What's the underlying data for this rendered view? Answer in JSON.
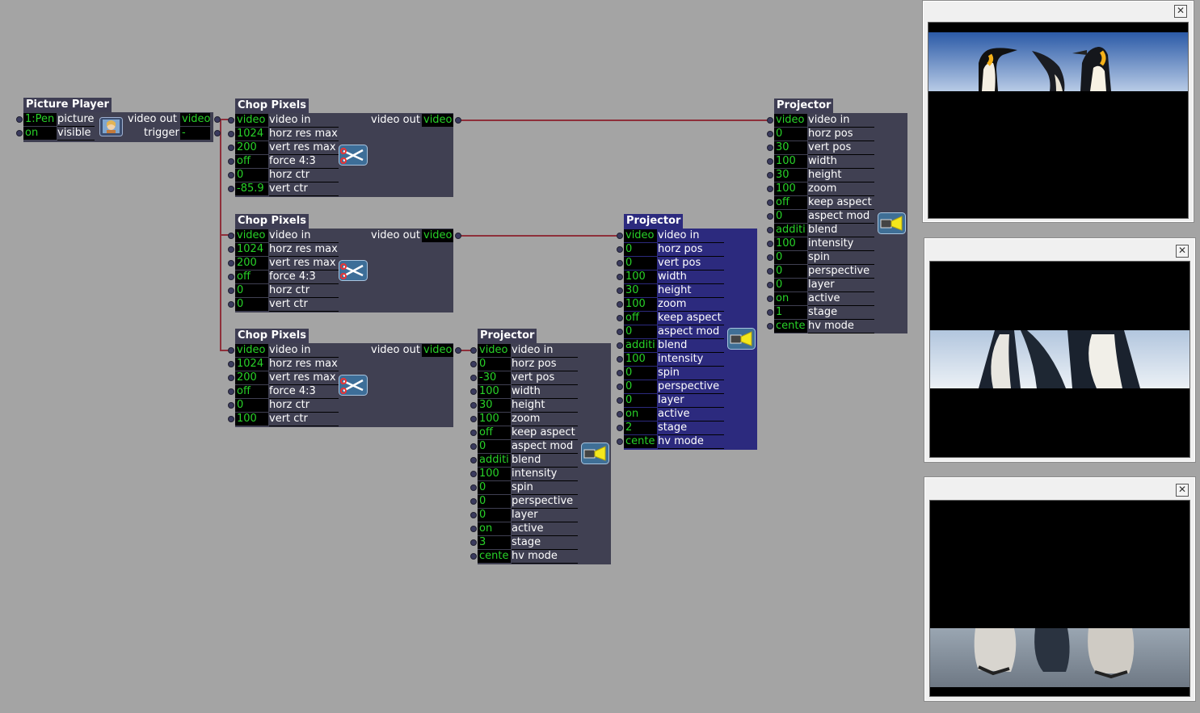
{
  "colors": {
    "background": "#a4a4a4",
    "module": "#404052",
    "selected_module": "#2c2a7e",
    "value_text": "#28d228",
    "wire": "#8e2f3a"
  },
  "picture_player": {
    "title": "Picture Player",
    "inputs": [
      {
        "value": "1:Pen",
        "label": "picture"
      },
      {
        "value": "on",
        "label": "visible"
      }
    ],
    "outputs": [
      {
        "label": "video out",
        "value": "video"
      },
      {
        "label": "trigger",
        "value": "-"
      }
    ],
    "icon": "picture-thumbnail-icon"
  },
  "chop1": {
    "title": "Chop Pixels",
    "out_label": "video out",
    "out_value": "video",
    "rows": [
      {
        "value": "video",
        "label": "video in"
      },
      {
        "value": "1024",
        "label": "horz res max"
      },
      {
        "value": "200",
        "label": "vert res max"
      },
      {
        "value": "off",
        "label": "force 4:3"
      },
      {
        "value": "0",
        "label": "horz ctr"
      },
      {
        "value": "-85.9",
        "label": "vert ctr"
      }
    ]
  },
  "chop2": {
    "title": "Chop Pixels",
    "out_label": "video out",
    "out_value": "video",
    "rows": [
      {
        "value": "video",
        "label": "video in"
      },
      {
        "value": "1024",
        "label": "horz res max"
      },
      {
        "value": "200",
        "label": "vert res max"
      },
      {
        "value": "off",
        "label": "force 4:3"
      },
      {
        "value": "0",
        "label": "horz ctr"
      },
      {
        "value": "0",
        "label": "vert ctr"
      }
    ]
  },
  "chop3": {
    "title": "Chop Pixels",
    "out_label": "video out",
    "out_value": "video",
    "rows": [
      {
        "value": "video",
        "label": "video in"
      },
      {
        "value": "1024",
        "label": "horz res max"
      },
      {
        "value": "200",
        "label": "vert res max"
      },
      {
        "value": "off",
        "label": "force 4:3"
      },
      {
        "value": "0",
        "label": "horz ctr"
      },
      {
        "value": "100",
        "label": "vert ctr"
      }
    ]
  },
  "proj1": {
    "title": "Projector",
    "rows": [
      {
        "value": "video",
        "label": "video in"
      },
      {
        "value": "0",
        "label": "horz pos"
      },
      {
        "value": "30",
        "label": "vert pos"
      },
      {
        "value": "100",
        "label": "width"
      },
      {
        "value": "30",
        "label": "height"
      },
      {
        "value": "100",
        "label": "zoom"
      },
      {
        "value": "off",
        "label": "keep aspect"
      },
      {
        "value": "0",
        "label": "aspect mod"
      },
      {
        "value": "additi",
        "label": "blend"
      },
      {
        "value": "100",
        "label": "intensity"
      },
      {
        "value": "0",
        "label": "spin"
      },
      {
        "value": "0",
        "label": "perspective"
      },
      {
        "value": "0",
        "label": "layer"
      },
      {
        "value": "on",
        "label": "active"
      },
      {
        "value": "1",
        "label": "stage"
      },
      {
        "value": "cente",
        "label": "hv mode"
      }
    ]
  },
  "proj2": {
    "title": "Projector",
    "rows": [
      {
        "value": "video",
        "label": "video in"
      },
      {
        "value": "0",
        "label": "horz pos"
      },
      {
        "value": "0",
        "label": "vert pos"
      },
      {
        "value": "100",
        "label": "width"
      },
      {
        "value": "30",
        "label": "height"
      },
      {
        "value": "100",
        "label": "zoom"
      },
      {
        "value": "off",
        "label": "keep aspect"
      },
      {
        "value": "0",
        "label": "aspect mod"
      },
      {
        "value": "additi",
        "label": "blend"
      },
      {
        "value": "100",
        "label": "intensity"
      },
      {
        "value": "0",
        "label": "spin"
      },
      {
        "value": "0",
        "label": "perspective"
      },
      {
        "value": "0",
        "label": "layer"
      },
      {
        "value": "on",
        "label": "active"
      },
      {
        "value": "2",
        "label": "stage"
      },
      {
        "value": "cente",
        "label": "hv mode"
      }
    ]
  },
  "proj3": {
    "title": "Projector",
    "rows": [
      {
        "value": "video",
        "label": "video in"
      },
      {
        "value": "0",
        "label": "horz pos"
      },
      {
        "value": "-30",
        "label": "vert pos"
      },
      {
        "value": "100",
        "label": "width"
      },
      {
        "value": "30",
        "label": "height"
      },
      {
        "value": "100",
        "label": "zoom"
      },
      {
        "value": "off",
        "label": "keep aspect"
      },
      {
        "value": "0",
        "label": "aspect mod"
      },
      {
        "value": "additi",
        "label": "blend"
      },
      {
        "value": "100",
        "label": "intensity"
      },
      {
        "value": "0",
        "label": "spin"
      },
      {
        "value": "0",
        "label": "perspective"
      },
      {
        "value": "0",
        "label": "layer"
      },
      {
        "value": "on",
        "label": "active"
      },
      {
        "value": "3",
        "label": "stage"
      },
      {
        "value": "cente",
        "label": "hv mode"
      }
    ]
  },
  "stage_windows": [
    {
      "close": "✕",
      "content": "penguin-heads-image"
    },
    {
      "close": "✕",
      "content": "penguin-bodies-image"
    },
    {
      "close": "✕",
      "content": "penguin-feet-image"
    }
  ]
}
